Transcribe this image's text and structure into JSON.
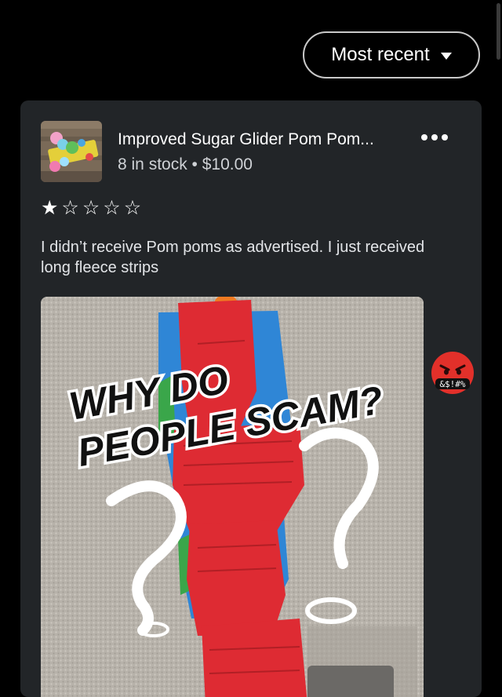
{
  "sort": {
    "label": "Most recent"
  },
  "review_card": {
    "product": {
      "title": "Improved Sugar Glider Pom Pom...",
      "meta": "8 in stock • $10.00"
    },
    "rating": 1,
    "rating_max": 5,
    "stars": [
      "★",
      "☆",
      "☆",
      "☆",
      "☆"
    ],
    "text": "I didn’t receive Pom poms as advertised. I just received long fleece strips",
    "photo": {
      "caption_line1": "WHY DO",
      "caption_line2": "PEOPLE SCAM?",
      "emoji_text": "&$!#%"
    }
  },
  "icons": {
    "more": "more-horizontal-icon",
    "sort_caret": "caret-down-icon"
  }
}
